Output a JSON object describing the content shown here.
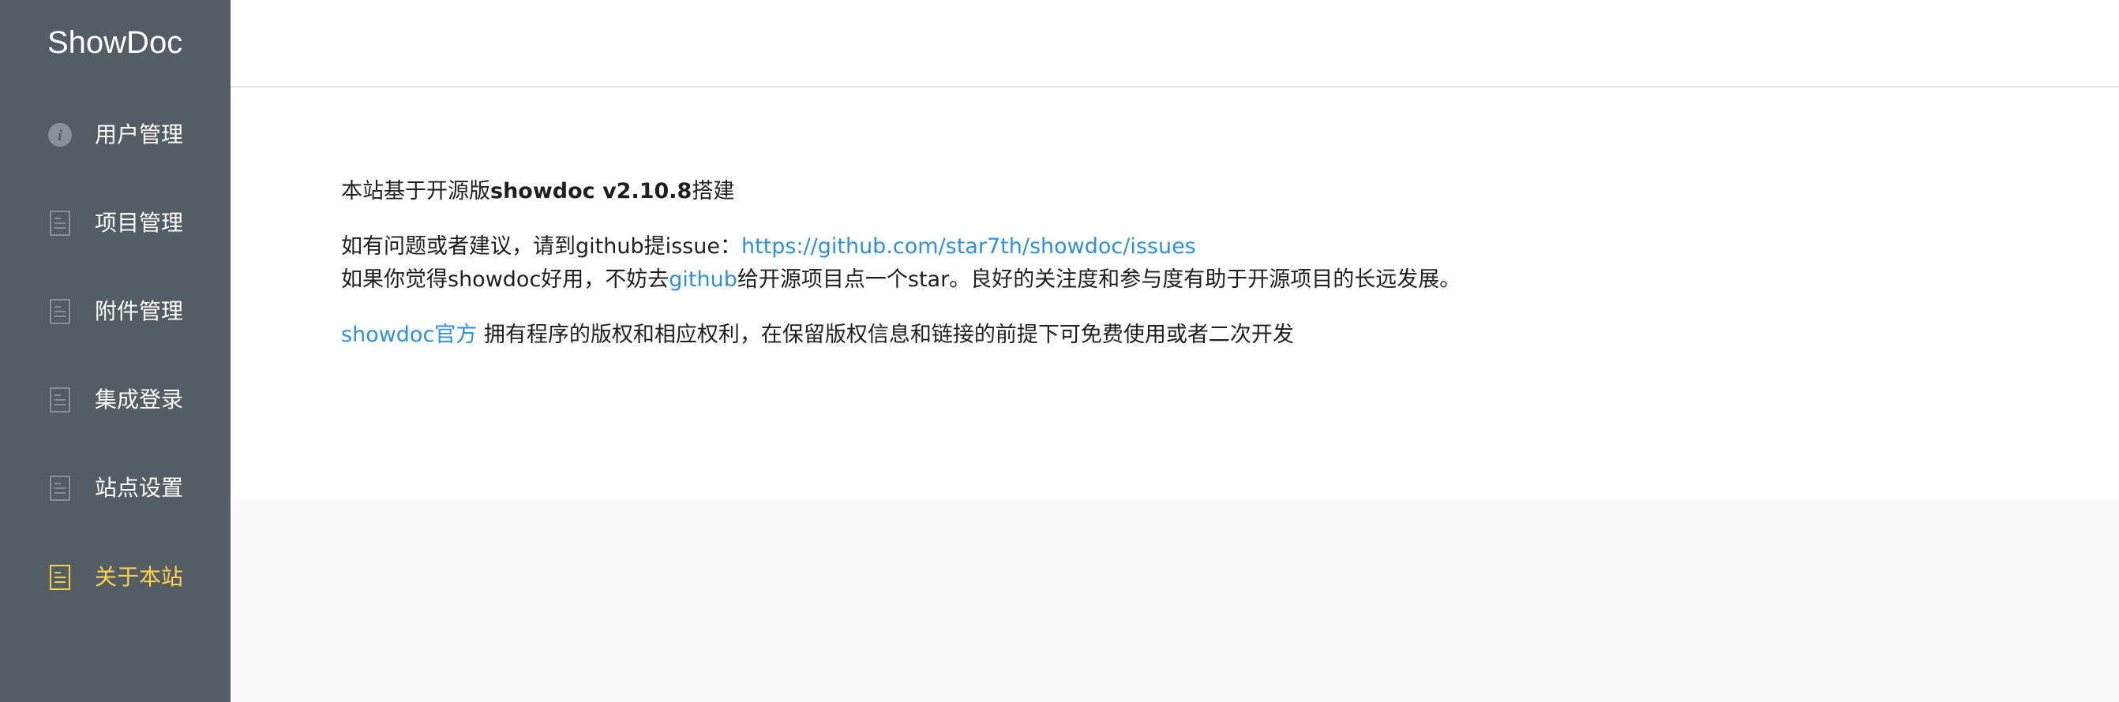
{
  "app": {
    "logo": "ShowDoc"
  },
  "sidebar": {
    "items": [
      {
        "label": "用户管理",
        "icon": "info-circle-icon",
        "active": false
      },
      {
        "label": "项目管理",
        "icon": "document-icon",
        "active": false
      },
      {
        "label": "附件管理",
        "icon": "document-icon",
        "active": false
      },
      {
        "label": "集成登录",
        "icon": "document-icon",
        "active": false
      },
      {
        "label": "站点设置",
        "icon": "document-icon",
        "active": false
      },
      {
        "label": "关于本站",
        "icon": "document-icon",
        "active": true
      }
    ]
  },
  "about": {
    "line1_prefix": "本站基于开源版",
    "line1_bold": "showdoc v2.10.8",
    "line1_suffix": "搭建",
    "line2_prefix": "如有问题或者建议，请到github提issue：",
    "line2_link": "https://github.com/star7th/showdoc/issues",
    "line3_prefix": "如果你觉得showdoc好用，不妨去",
    "line3_link": "github",
    "line3_suffix": "给开源项目点一个star。良好的关注度和参与度有助于开源项目的长远发展。",
    "line4_link": "showdoc官方",
    "line4_suffix": " 拥有程序的版权和相应权利，在保留版权信息和链接的前提下可免费使用或者二次开发"
  },
  "colors": {
    "sidebar_bg": "#545c64",
    "active_text": "#ffd04b",
    "link": "#2f8fe0"
  }
}
